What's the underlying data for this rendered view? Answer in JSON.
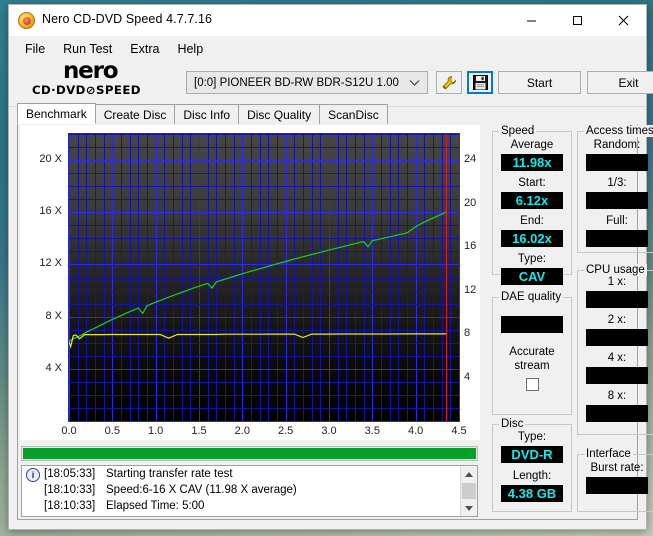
{
  "window": {
    "title": "Nero CD-DVD Speed 4.7.7.16",
    "icon": "nero-icon",
    "minimize": "─",
    "maximize": "☐",
    "close": "✕"
  },
  "menu": {
    "items": [
      "File",
      "Run Test",
      "Extra",
      "Help"
    ]
  },
  "toolbar": {
    "logo_main": "nero",
    "logo_sub_left": "CD·DVD",
    "logo_slash": "⊘",
    "logo_sub_right": "SPEED",
    "drive": "[0:0]  PIONEER BD-RW  BDR-S12U 1.00",
    "icon_tool": "wrench-icon",
    "icon_save": "save-floppy-icon",
    "start_label": "Start",
    "exit_label": "Exit"
  },
  "tabs": [
    {
      "label": "Benchmark",
      "active": true
    },
    {
      "label": "Create Disc",
      "active": false
    },
    {
      "label": "Disc Info",
      "active": false
    },
    {
      "label": "Disc Quality",
      "active": false
    },
    {
      "label": "ScanDisc",
      "active": false
    }
  ],
  "chart_data": {
    "type": "line",
    "title": "",
    "xlabel": "",
    "ylabel": "",
    "xlim": [
      0.0,
      4.5
    ],
    "ylim_left": [
      0,
      22
    ],
    "ylim_right": [
      0,
      26.4
    ],
    "grid": true,
    "left_axis_ticks": [
      "20 X",
      "16 X",
      "12 X",
      "8 X",
      "4 X"
    ],
    "left_axis_values": [
      20,
      16,
      12,
      8,
      4
    ],
    "right_axis_ticks": [
      "24",
      "20",
      "16",
      "12",
      "8",
      "4"
    ],
    "right_axis_values": [
      24,
      20,
      16,
      12,
      8,
      4
    ],
    "x_ticks": [
      "0.0",
      "0.5",
      "1.0",
      "1.5",
      "2.0",
      "2.5",
      "3.0",
      "3.5",
      "4.0",
      "4.5"
    ],
    "x_values": [
      0.0,
      0.5,
      1.0,
      1.5,
      2.0,
      2.5,
      3.0,
      3.5,
      4.0,
      4.5
    ],
    "end_marker_x": 4.35,
    "end_marker_color": "#e01b1b",
    "series": [
      {
        "name": "Transfer rate",
        "color": "#22cc22",
        "x": [
          0.0,
          0.05,
          0.1,
          0.15,
          0.2,
          0.25,
          0.3,
          0.35,
          0.4,
          0.45,
          0.5,
          0.55,
          0.6,
          0.65,
          0.7,
          0.75,
          0.8,
          0.85,
          0.9,
          0.95,
          1.0,
          1.1,
          1.2,
          1.3,
          1.4,
          1.5,
          1.6,
          1.65,
          1.7,
          1.8,
          1.9,
          2.0,
          2.1,
          2.2,
          2.3,
          2.4,
          2.5,
          2.6,
          2.7,
          2.8,
          2.9,
          3.0,
          3.1,
          3.2,
          3.3,
          3.4,
          3.45,
          3.5,
          3.6,
          3.7,
          3.8,
          3.9,
          4.0,
          4.1,
          4.2,
          4.3,
          4.35
        ],
        "y": [
          6.12,
          6.3,
          6.45,
          6.62,
          6.8,
          6.97,
          7.13,
          7.3,
          7.46,
          7.62,
          7.78,
          7.93,
          8.08,
          8.23,
          8.38,
          8.52,
          8.66,
          8.25,
          8.84,
          8.98,
          9.11,
          9.37,
          9.62,
          9.86,
          10.1,
          10.33,
          10.55,
          10.2,
          10.66,
          10.87,
          11.08,
          11.28,
          11.48,
          11.67,
          11.86,
          12.05,
          12.23,
          12.41,
          12.59,
          12.76,
          12.93,
          13.1,
          13.27,
          13.43,
          13.59,
          13.75,
          13.35,
          13.82,
          13.97,
          14.12,
          14.27,
          14.42,
          14.9,
          15.25,
          15.55,
          15.85,
          16.02
        ]
      },
      {
        "name": "Rotation speed",
        "color": "#e8e828",
        "x": [
          0.0,
          0.02,
          0.05,
          0.08,
          0.12,
          0.18,
          0.25,
          0.35,
          0.5,
          0.65,
          0.8,
          0.95,
          1.05,
          1.15,
          1.25,
          1.4,
          1.5,
          1.6,
          1.7,
          1.8,
          1.9,
          2.0,
          2.1,
          2.2,
          2.3,
          2.4,
          2.5,
          2.6,
          2.7,
          2.8,
          2.9,
          3.0,
          3.1,
          3.2,
          3.3,
          3.4,
          3.5,
          3.7,
          3.9,
          4.1,
          4.3,
          4.35
        ],
        "y": [
          6.1,
          5.7,
          6.55,
          6.6,
          6.3,
          6.62,
          6.62,
          6.62,
          6.63,
          6.63,
          6.63,
          6.63,
          6.63,
          6.35,
          6.63,
          6.63,
          6.63,
          6.63,
          6.63,
          6.65,
          6.65,
          6.65,
          6.65,
          6.65,
          6.66,
          6.66,
          6.66,
          6.66,
          6.4,
          6.66,
          6.66,
          6.66,
          6.67,
          6.67,
          6.67,
          6.67,
          6.67,
          6.67,
          6.68,
          6.68,
          6.68,
          6.68
        ]
      }
    ]
  },
  "speed": {
    "group_label": "Speed",
    "average_label": "Average",
    "average_value": "11.98x",
    "start_label": "Start:",
    "start_value": "6.12x",
    "end_label": "End:",
    "end_value": "16.02x",
    "type_label": "Type:",
    "type_value": "CAV"
  },
  "dae": {
    "group_label": "DAE quality",
    "value": "",
    "accurate_label_l1": "Accurate",
    "accurate_label_l2": "stream",
    "checked": false
  },
  "disc": {
    "group_label": "Disc",
    "type_label": "Type:",
    "type_value": "DVD-R",
    "length_label": "Length:",
    "length_value": "4.38 GB"
  },
  "access": {
    "group_label": "Access times",
    "random_label": "Random:",
    "random_value": "",
    "third_label": "1/3:",
    "third_value": "",
    "full_label": "Full:",
    "full_value": ""
  },
  "cpu": {
    "group_label": "CPU usage",
    "x1_label": "1 x:",
    "x1_value": "",
    "x2_label": "2 x:",
    "x2_value": "",
    "x4_label": "4 x:",
    "x4_value": "",
    "x8_label": "8 x:",
    "x8_value": ""
  },
  "interface": {
    "group_label": "Interface",
    "burst_label": "Burst rate:",
    "burst_value": ""
  },
  "progress": {
    "percent": 100,
    "color": "#06a02a"
  },
  "log": {
    "entries": [
      {
        "time": "[18:05:33]",
        "text": "Starting transfer rate test",
        "has_icon": true
      },
      {
        "time": "[18:10:33]",
        "text": "Speed:6-16 X CAV (11.98 X average)",
        "has_icon": false
      },
      {
        "time": "[18:10:33]",
        "text": "Elapsed Time:  5:00",
        "has_icon": false
      }
    ]
  }
}
